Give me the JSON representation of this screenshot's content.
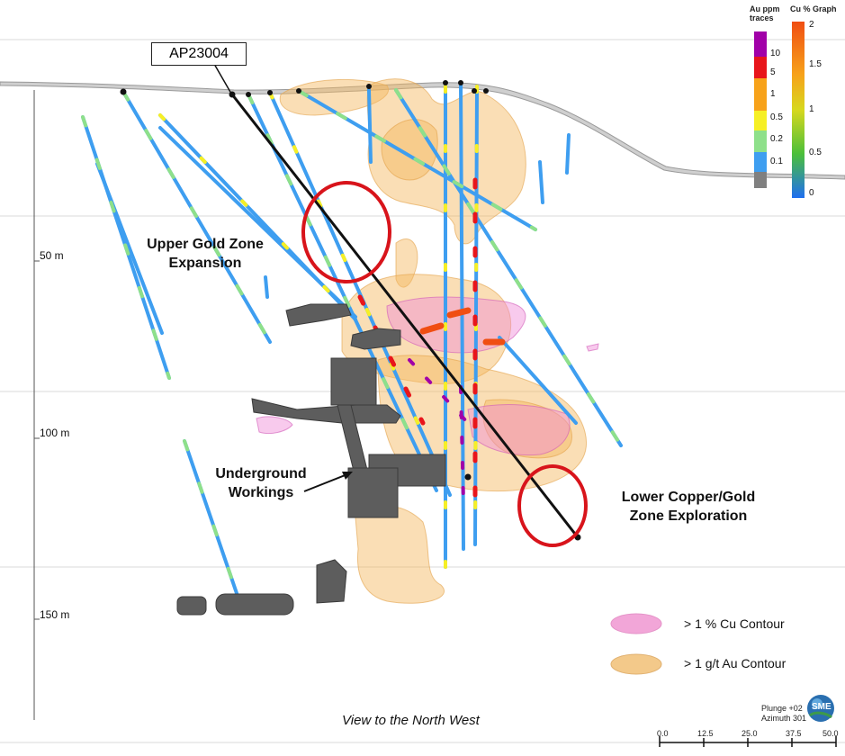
{
  "drillhole": {
    "label": "AP23004"
  },
  "zones": {
    "upper_gold": "Upper Gold Zone\nExpansion",
    "underground": "Underground\nWorkings",
    "lower_cu_au": "Lower Copper/Gold\nZone Exploration"
  },
  "depth_labels": [
    "50 m",
    "100 m",
    "150 m"
  ],
  "au_scale": {
    "title": "Au ppm\ntraces",
    "ticks": [
      "10",
      "5",
      "1",
      "0.5",
      "0.2",
      "0.1"
    ],
    "colors": [
      "#a100a8",
      "#e8151b",
      "#f7a21a",
      "#f6ef25",
      "#8ee08a",
      "#3e9ef0",
      "#808080"
    ]
  },
  "cu_scale": {
    "title": "Cu % Graph",
    "ticks": [
      "2",
      "1.5",
      "1",
      "0.5",
      "0"
    ],
    "colors": [
      "#f04e12",
      "#f7a21a",
      "#d7d81e",
      "#4bbf3a",
      "#1f6ff0"
    ]
  },
  "legend": {
    "cu_contour": "> 1 % Cu Contour",
    "au_contour": "> 1 g/t Au Contour",
    "cu_color": "#f2a6d8",
    "au_color": "#f3c98a"
  },
  "view_caption": "View to the North West",
  "orientation": {
    "plunge": "Plunge +02",
    "azimuth": "Azimuth 301"
  },
  "logo_text": "SME",
  "scale_bar": {
    "ticks": [
      "0.0",
      "12.5",
      "25.0",
      "37.5",
      "50.0"
    ]
  },
  "colors": {
    "highlight_ellipse": "#d8141b",
    "drill_trace": "#111111",
    "workings": "#5d5d5d"
  }
}
